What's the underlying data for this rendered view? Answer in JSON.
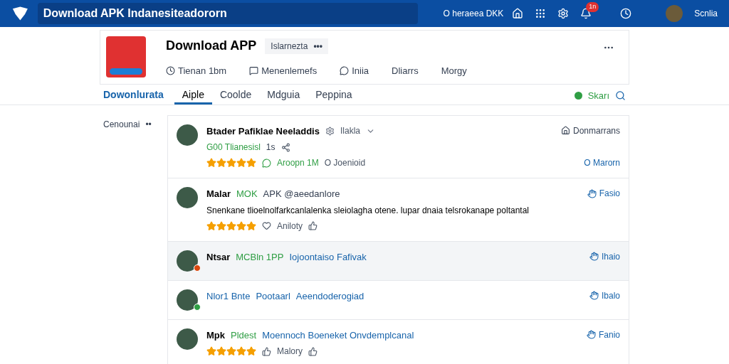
{
  "topbar": {
    "title": "Download APK Indanesiteadororn",
    "search_text": "O heraeea DKK",
    "notification_count": "1n",
    "user_name": "Scnlia"
  },
  "app": {
    "title": "Download APP",
    "tag": "Islarnezta",
    "tag_more": "•••",
    "meta": [
      {
        "text": "Tienan 1bm",
        "kind": "clock"
      },
      {
        "text": "Menenlemefs",
        "kind": "comment"
      },
      {
        "text": "Iniia",
        "kind": "chat"
      },
      {
        "text": "Dliarrs",
        "kind": "plain"
      },
      {
        "text": "Morgy",
        "kind": "plain"
      }
    ]
  },
  "tabs": [
    {
      "label": "Dowonlurata",
      "selected": false,
      "kind": "brand"
    },
    {
      "label": "Aiple",
      "selected": true,
      "kind": "tab"
    },
    {
      "label": "Coolde",
      "selected": false,
      "kind": "tab"
    },
    {
      "label": "Mdguia",
      "selected": false,
      "kind": "tab"
    },
    {
      "label": "Peppina",
      "selected": false,
      "kind": "tab"
    }
  ],
  "status_label": "Skarı",
  "sidebar": {
    "label": "Cenounai",
    "more": "••"
  },
  "reviews": [
    {
      "highlighted": false,
      "segments": [
        {
          "text": "Btader Pafiklae Neeladdis",
          "kind": "name"
        }
      ],
      "meta": "Ilakla",
      "sub": [
        {
          "text": "G00 Tlianesisl",
          "kind": "green"
        },
        {
          "text": "1s",
          "kind": "plain"
        }
      ],
      "stars": 5,
      "footer": [
        {
          "text": "Aroopn 1M",
          "kind": "green"
        },
        {
          "text": "O Joenioid",
          "kind": "plain"
        }
      ],
      "action": {
        "text": "Donmarrans",
        "kind": "home"
      },
      "action2": "O Marorn"
    },
    {
      "highlighted": false,
      "segments": [
        {
          "text": "Malar",
          "kind": "name"
        },
        {
          "text": "MOK",
          "kind": "green"
        },
        {
          "text": "APK @aeedanlore",
          "kind": "plain"
        }
      ],
      "body": "Snenkane tlioelnolfarkcanlalenka sleiolagha otene. lupar dnaia telsrokanape poltantal",
      "stars": 5,
      "footer": [
        {
          "text": "Aniloty",
          "kind": "heart"
        }
      ],
      "action": {
        "text": "Fasio",
        "kind": "hand"
      }
    },
    {
      "highlighted": true,
      "color": "#d9480f",
      "segments": [
        {
          "text": "Ntsar",
          "kind": "name"
        },
        {
          "text": "MCBln 1PP",
          "kind": "green"
        },
        {
          "text": "Iojoontaiso Fafivak",
          "kind": "blue"
        }
      ],
      "action": {
        "text": "Ihaio",
        "kind": "hand"
      }
    },
    {
      "highlighted": false,
      "color": "#2f9e44",
      "segments": [
        {
          "text": "Nlor1 Bnte",
          "kind": "blue"
        },
        {
          "text": "Pootaarl",
          "kind": "blue"
        },
        {
          "text": "Aeendoderogiad",
          "kind": "blue"
        }
      ],
      "action": {
        "text": "Ibalo",
        "kind": "hand"
      }
    },
    {
      "highlighted": false,
      "segments": [
        {
          "text": "Mpk",
          "kind": "name"
        },
        {
          "text": "Pldest",
          "kind": "green"
        },
        {
          "text": "Moennoch Boeneket Onvdemplcanal",
          "kind": "blue"
        }
      ],
      "stars": 5,
      "footer": [
        {
          "text": "Malory",
          "kind": "thumb"
        }
      ],
      "action": {
        "text": "Fanio",
        "kind": "hand"
      }
    }
  ]
}
